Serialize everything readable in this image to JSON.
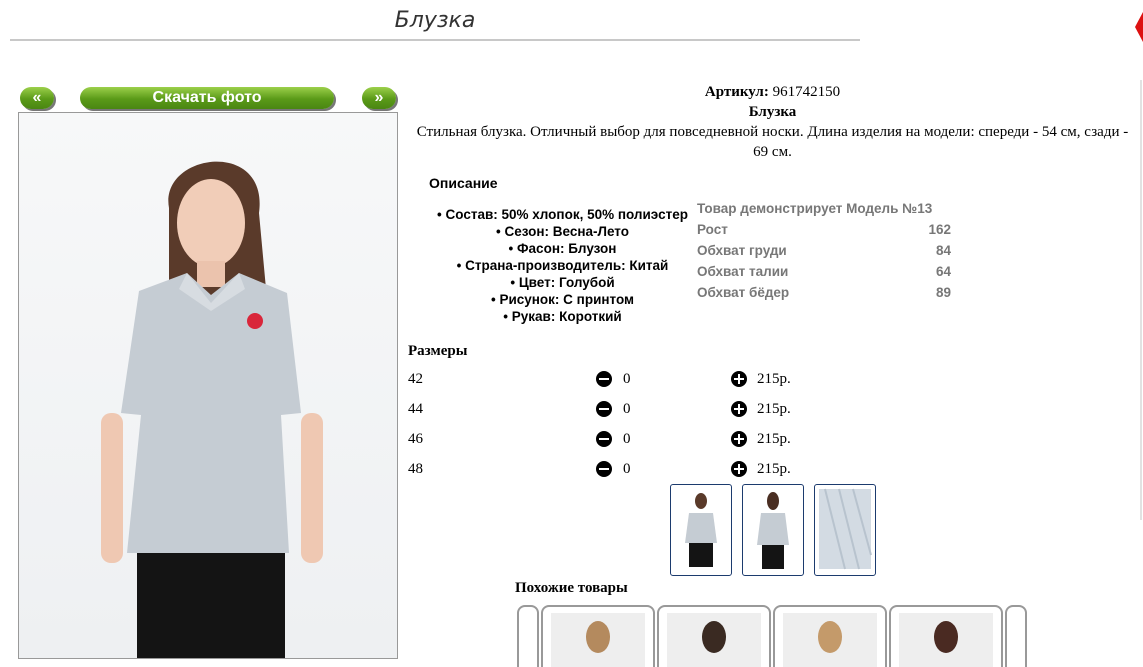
{
  "page": {
    "title": "Блузка"
  },
  "nav": {
    "prev_label": "«",
    "download_label": "Скачать фото",
    "next_label": "»"
  },
  "product": {
    "sku_label": "Артикул:",
    "sku": "961742150",
    "name": "Блузка",
    "description": "Стильная блузка. Отличный выбор для повседневной носки. Длина изделия на модели: спереди - 54 см, сзади - 69 см."
  },
  "description_section": {
    "heading": "Описание",
    "attributes": [
      "Состав: 50% хлопок, 50% полиэстер",
      "Сезон: Весна-Лето",
      "Фасон: Блузон",
      "Страна-производитель: Китай",
      "Цвет: Голубой",
      "Рисунок: С принтом",
      "Рукав: Короткий"
    ]
  },
  "model": {
    "title": "Товар демонстрирует Модель №13",
    "rows": [
      {
        "label": "Рост",
        "value": "162"
      },
      {
        "label": "Обхват груди",
        "value": "84"
      },
      {
        "label": "Обхват талии",
        "value": "64"
      },
      {
        "label": "Обхват бёдер",
        "value": "89"
      }
    ]
  },
  "sizes": {
    "heading": "Размеры",
    "rows": [
      {
        "size": "42",
        "qty": "0",
        "price": "215р."
      },
      {
        "size": "44",
        "qty": "0",
        "price": "215р."
      },
      {
        "size": "46",
        "qty": "0",
        "price": "215р."
      },
      {
        "size": "48",
        "qty": "0",
        "price": "215р."
      }
    ]
  },
  "similar": {
    "heading": "Похожие товары"
  },
  "icons": {
    "minus": "minus-circle-icon",
    "plus": "plus-circle-icon"
  },
  "colors": {
    "button_green": "#5a9a18",
    "thumb_border": "#1c3b6e",
    "blouse": "#c5ccd3"
  }
}
